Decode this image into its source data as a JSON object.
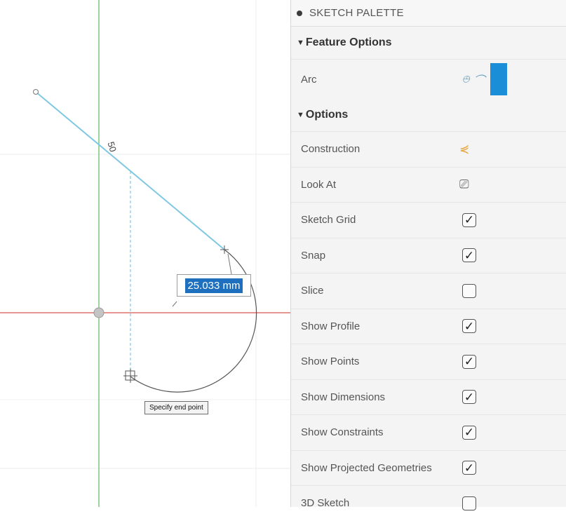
{
  "canvas": {
    "dimension_value": "25.033 mm",
    "dimension_label": "50",
    "tooltip": "Specify end point"
  },
  "palette": {
    "title": "SKETCH PALETTE",
    "feature_section": "Feature Options",
    "arc_label": "Arc",
    "options_section": "Options",
    "rows": [
      {
        "label": "Construction",
        "control": "construction-icon"
      },
      {
        "label": "Look At",
        "control": "look-at-icon"
      },
      {
        "label": "Sketch Grid",
        "control": "checkbox",
        "checked": true
      },
      {
        "label": "Snap",
        "control": "checkbox",
        "checked": true
      },
      {
        "label": "Slice",
        "control": "checkbox",
        "checked": false
      },
      {
        "label": "Show Profile",
        "control": "checkbox",
        "checked": true
      },
      {
        "label": "Show Points",
        "control": "checkbox",
        "checked": true
      },
      {
        "label": "Show Dimensions",
        "control": "checkbox",
        "checked": true
      },
      {
        "label": "Show Constraints",
        "control": "checkbox",
        "checked": true
      },
      {
        "label": "Show Projected Geometries",
        "control": "checkbox",
        "checked": true
      },
      {
        "label": "3D Sketch",
        "control": "checkbox",
        "checked": false
      }
    ]
  },
  "colors": {
    "sketch_line": "#7ec8e3",
    "x_axis": "#d9534f",
    "y_axis": "#5cb85c",
    "selected_arc_button": "#1a8fd8",
    "construction_icon": "#e8a33c"
  }
}
